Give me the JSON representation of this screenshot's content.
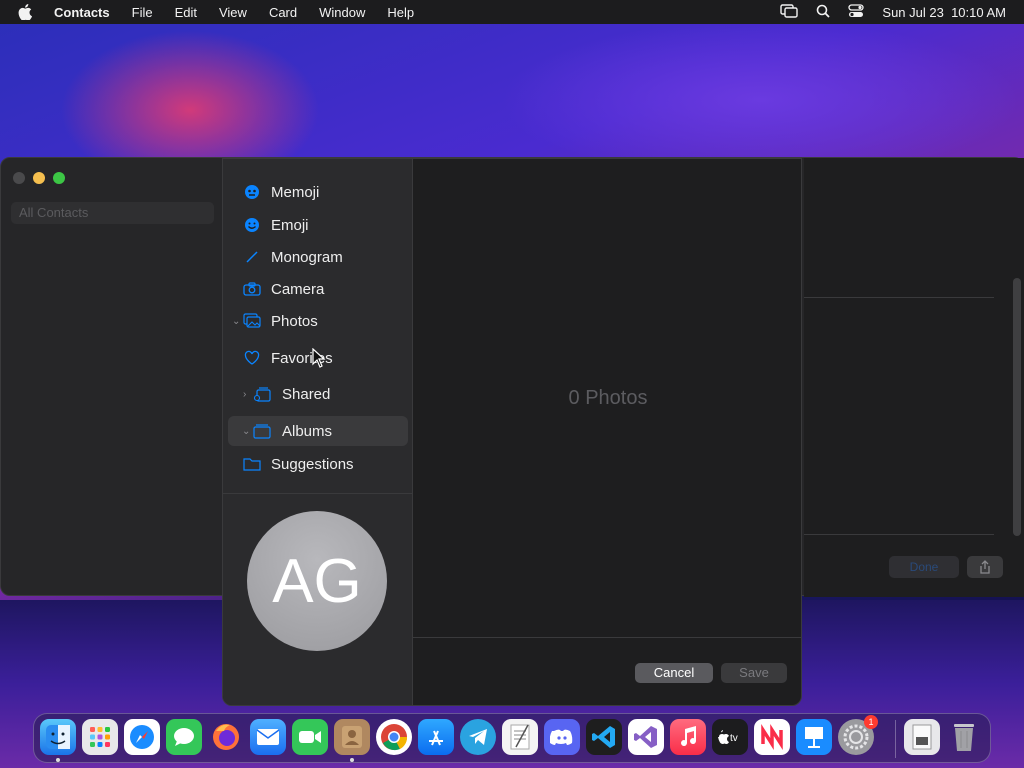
{
  "menubar": {
    "app_name": "Contacts",
    "items": [
      "File",
      "Edit",
      "View",
      "Card",
      "Window",
      "Help"
    ],
    "datetime": "Sun Jul 23  10:10 AM"
  },
  "contacts_window": {
    "search_placeholder": "All Contacts",
    "done_label": "Done"
  },
  "picker": {
    "sidebar": {
      "memoji": "Memoji",
      "emoji": "Emoji",
      "monogram": "Monogram",
      "camera": "Camera",
      "photos": "Photos",
      "favorites": "Favorites",
      "shared": "Shared",
      "albums": "Albums",
      "suggestions": "Suggestions"
    },
    "avatar_initials": "AG",
    "empty_message": "0 Photos",
    "cancel_label": "Cancel",
    "save_label": "Save"
  },
  "dock": {
    "apps": [
      "Finder",
      "Launchpad",
      "Safari",
      "Messages",
      "Firefox",
      "Mail",
      "FaceTime",
      "Contacts",
      "Chrome",
      "App Store",
      "Telegram",
      "TextEdit",
      "Discord",
      "VS Code",
      "Visual Studio",
      "Music",
      "TV",
      "News",
      "Keynote",
      "System Settings",
      "Preview",
      "Trash"
    ],
    "settings_badge": "1"
  },
  "colors": {
    "accent": "#0a84ff",
    "menubar": "#1c1c1e",
    "sidebar": "#2b2b2d"
  }
}
